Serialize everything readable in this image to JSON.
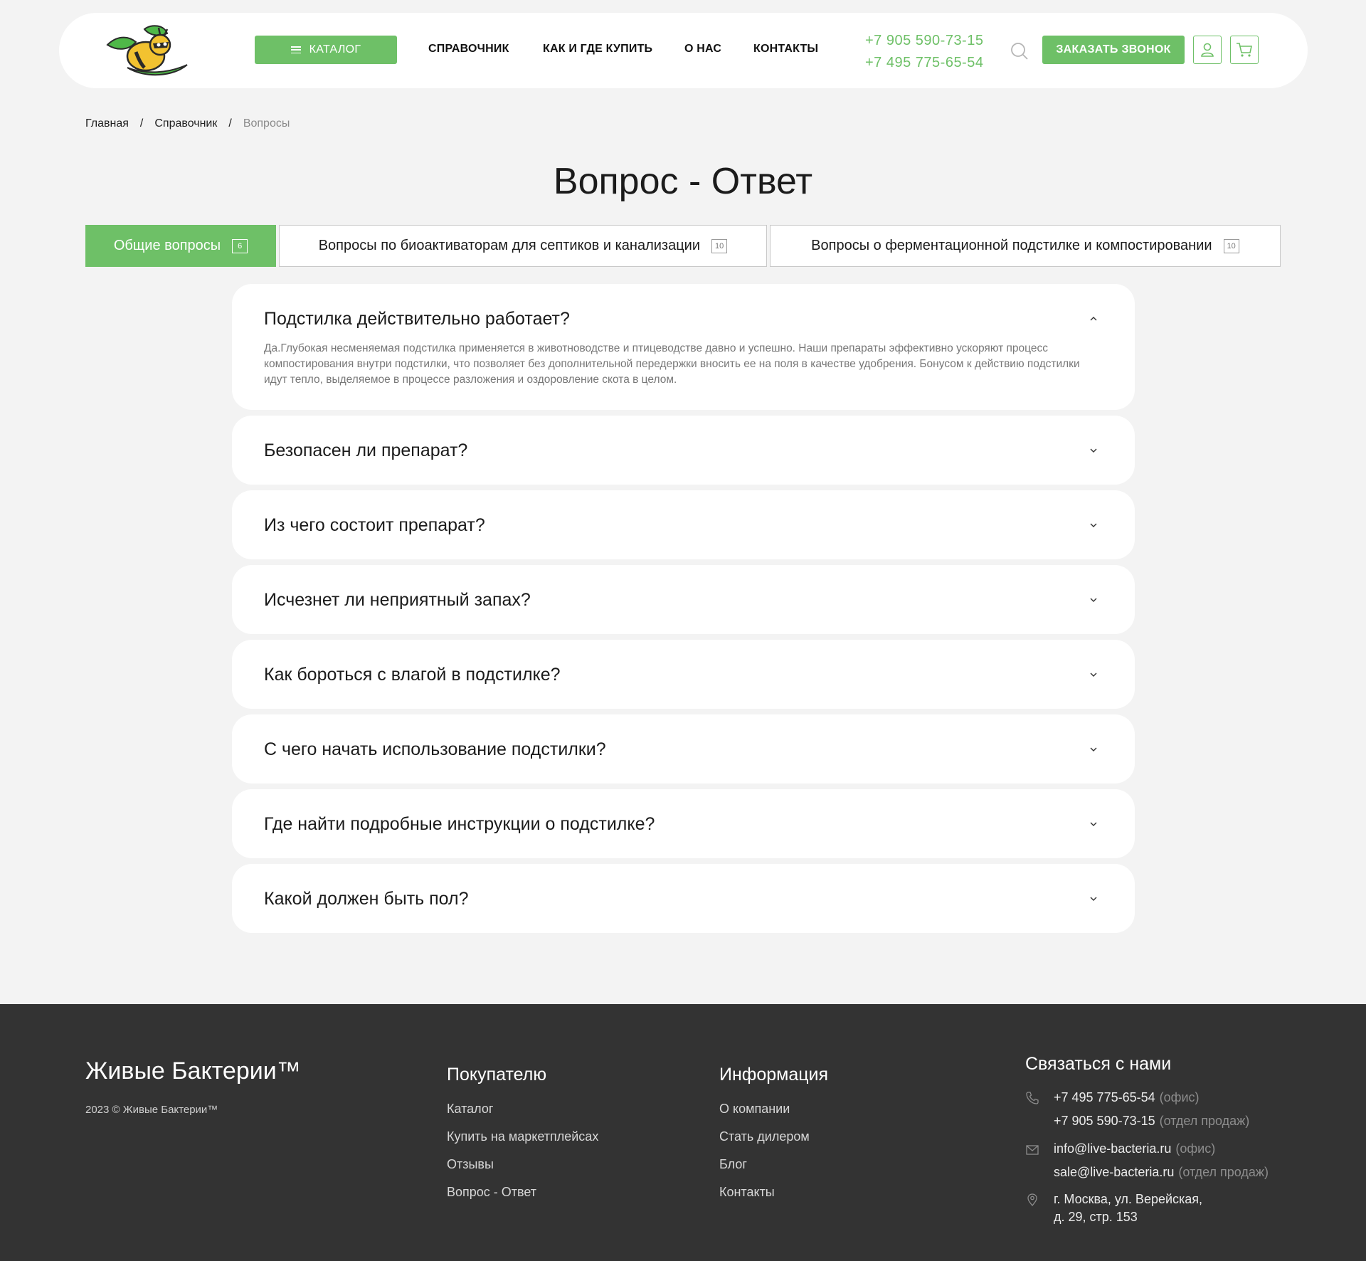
{
  "header": {
    "catalog_label": "КАТАЛОГ",
    "nav": [
      "СПРАВОЧНИК",
      "КАК И ГДЕ КУПИТЬ",
      "О НАС",
      "КОНТАКТЫ"
    ],
    "phones": [
      "+7 905 590-73-15",
      "+7 495 775-65-54"
    ],
    "callback_label": "ЗАКАЗАТЬ ЗВОНОК"
  },
  "breadcrumb": {
    "items": [
      "Главная",
      "Справочник",
      "Вопросы"
    ],
    "separator": "/"
  },
  "page_title": "Вопрос - Ответ",
  "tabs": [
    {
      "label": "Общие вопросы",
      "count": "6",
      "active": true
    },
    {
      "label": "Вопросы по биоактиваторам для септиков и канализации",
      "count": "10",
      "active": false
    },
    {
      "label": "Вопросы о ферментационной подстилке и компостировании",
      "count": "10",
      "active": false
    }
  ],
  "faq": [
    {
      "question": "Подстилка действительно работает?",
      "answer": "Да.Глубокая несменяемая подстилка применяется в животноводстве и птицеводстве давно и успешно. Наши препараты эффективно ускоряют процесс компостирования внутри подстилки, что позволяет без дополнительной передержки вносить ее на поля в качестве удобрения. Бонусом к действию подстилки идут тепло, выделяемое в процессе разложения и оздоровление скота в целом.",
      "open": true
    },
    {
      "question": "Безопасен ли препарат?",
      "open": false
    },
    {
      "question": "Из чего состоит препарат?",
      "open": false
    },
    {
      "question": "Исчезнет ли неприятный запах?",
      "open": false
    },
    {
      "question": "Как бороться с влагой в подстилке?",
      "open": false
    },
    {
      "question": "С чего начать использование подстилки?",
      "open": false
    },
    {
      "question": "Где найти подробные инструкции о подстилке?",
      "open": false
    },
    {
      "question": "Какой должен быть пол?",
      "open": false
    }
  ],
  "footer": {
    "brand": "Живые Бактерии™",
    "copyright": "2023 © Живые Бактерии™",
    "buyer": {
      "title": "Покупателю",
      "links": [
        "Каталог",
        "Купить на маркетплейсах",
        "Отзывы",
        "Вопрос - Ответ"
      ]
    },
    "info": {
      "title": "Информация",
      "links": [
        "О компании",
        "Стать дилером",
        "Блог",
        "Контакты"
      ]
    },
    "contact": {
      "title": "Связаться с нами",
      "phone1": "+7 495 775-65-54",
      "phone1_note": "(офис)",
      "phone2": "+7 905 590-73-15",
      "phone2_note": "(отдел продаж)",
      "email1": "info@live-bacteria.ru",
      "email1_note": "(офис)",
      "email2": "sale@live-bacteria.ru",
      "email2_note": "(отдел продаж)",
      "address1": "г. Москва, ул. Верейская,",
      "address2": "д. 29, стр. 153"
    }
  },
  "colors": {
    "accent": "#6ec067",
    "page_bg": "#f3f3f3",
    "footer_bg": "#333333"
  }
}
